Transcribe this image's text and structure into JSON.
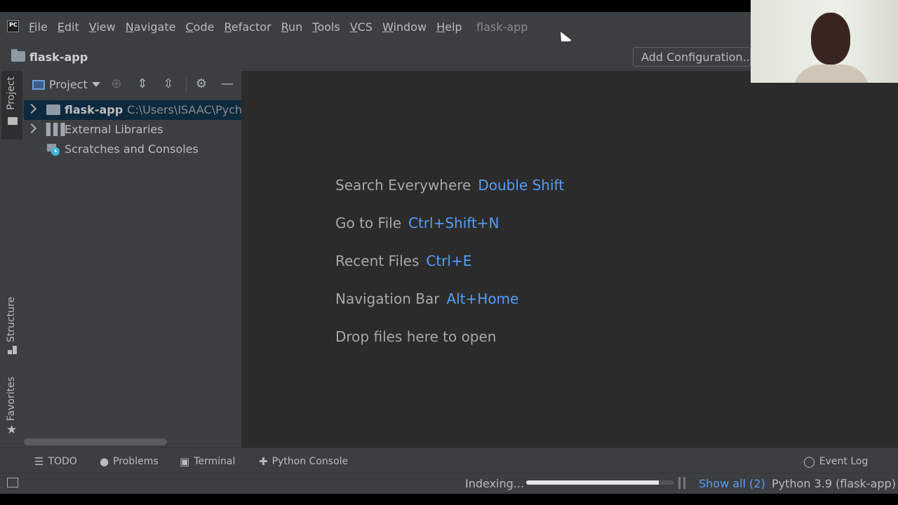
{
  "app": {
    "logo_text": "PC",
    "window_title": "flask-app"
  },
  "menu": {
    "items": [
      "File",
      "Edit",
      "View",
      "Navigate",
      "Code",
      "Refactor",
      "Run",
      "Tools",
      "VCS",
      "Window",
      "Help"
    ]
  },
  "navbar": {
    "project_name": "flask-app",
    "add_configuration": "Add Configuration..."
  },
  "left_stripe": {
    "project": "Project",
    "structure": "Structure",
    "favorites": "Favorites"
  },
  "project_panel": {
    "view_label": "Project",
    "tree": [
      {
        "label": "flask-app",
        "path": "C:\\Users\\ISAAC\\Pychar"
      },
      {
        "label": "External Libraries"
      },
      {
        "label": "Scratches and Consoles"
      }
    ]
  },
  "editor": {
    "hints": [
      {
        "label": "Search Everywhere",
        "key": "Double Shift"
      },
      {
        "label": "Go to File",
        "key": "Ctrl+Shift+N"
      },
      {
        "label": "Recent Files",
        "key": "Ctrl+E"
      },
      {
        "label": "Navigation Bar",
        "key": "Alt+Home"
      }
    ],
    "drop_text": "Drop files here to open"
  },
  "tool_windows": {
    "todo": "TODO",
    "problems": "Problems",
    "terminal": "Terminal",
    "python_console": "Python Console",
    "event_log": "Event Log"
  },
  "status": {
    "indexing": "Indexing...",
    "indexing_progress": 0.9,
    "show_all": "Show all (2)",
    "interpreter": "Python 3.9 (flask-app)"
  },
  "colors": {
    "accent": "#589df6",
    "background": "#2b2b2b",
    "panel": "#3c3f41"
  }
}
